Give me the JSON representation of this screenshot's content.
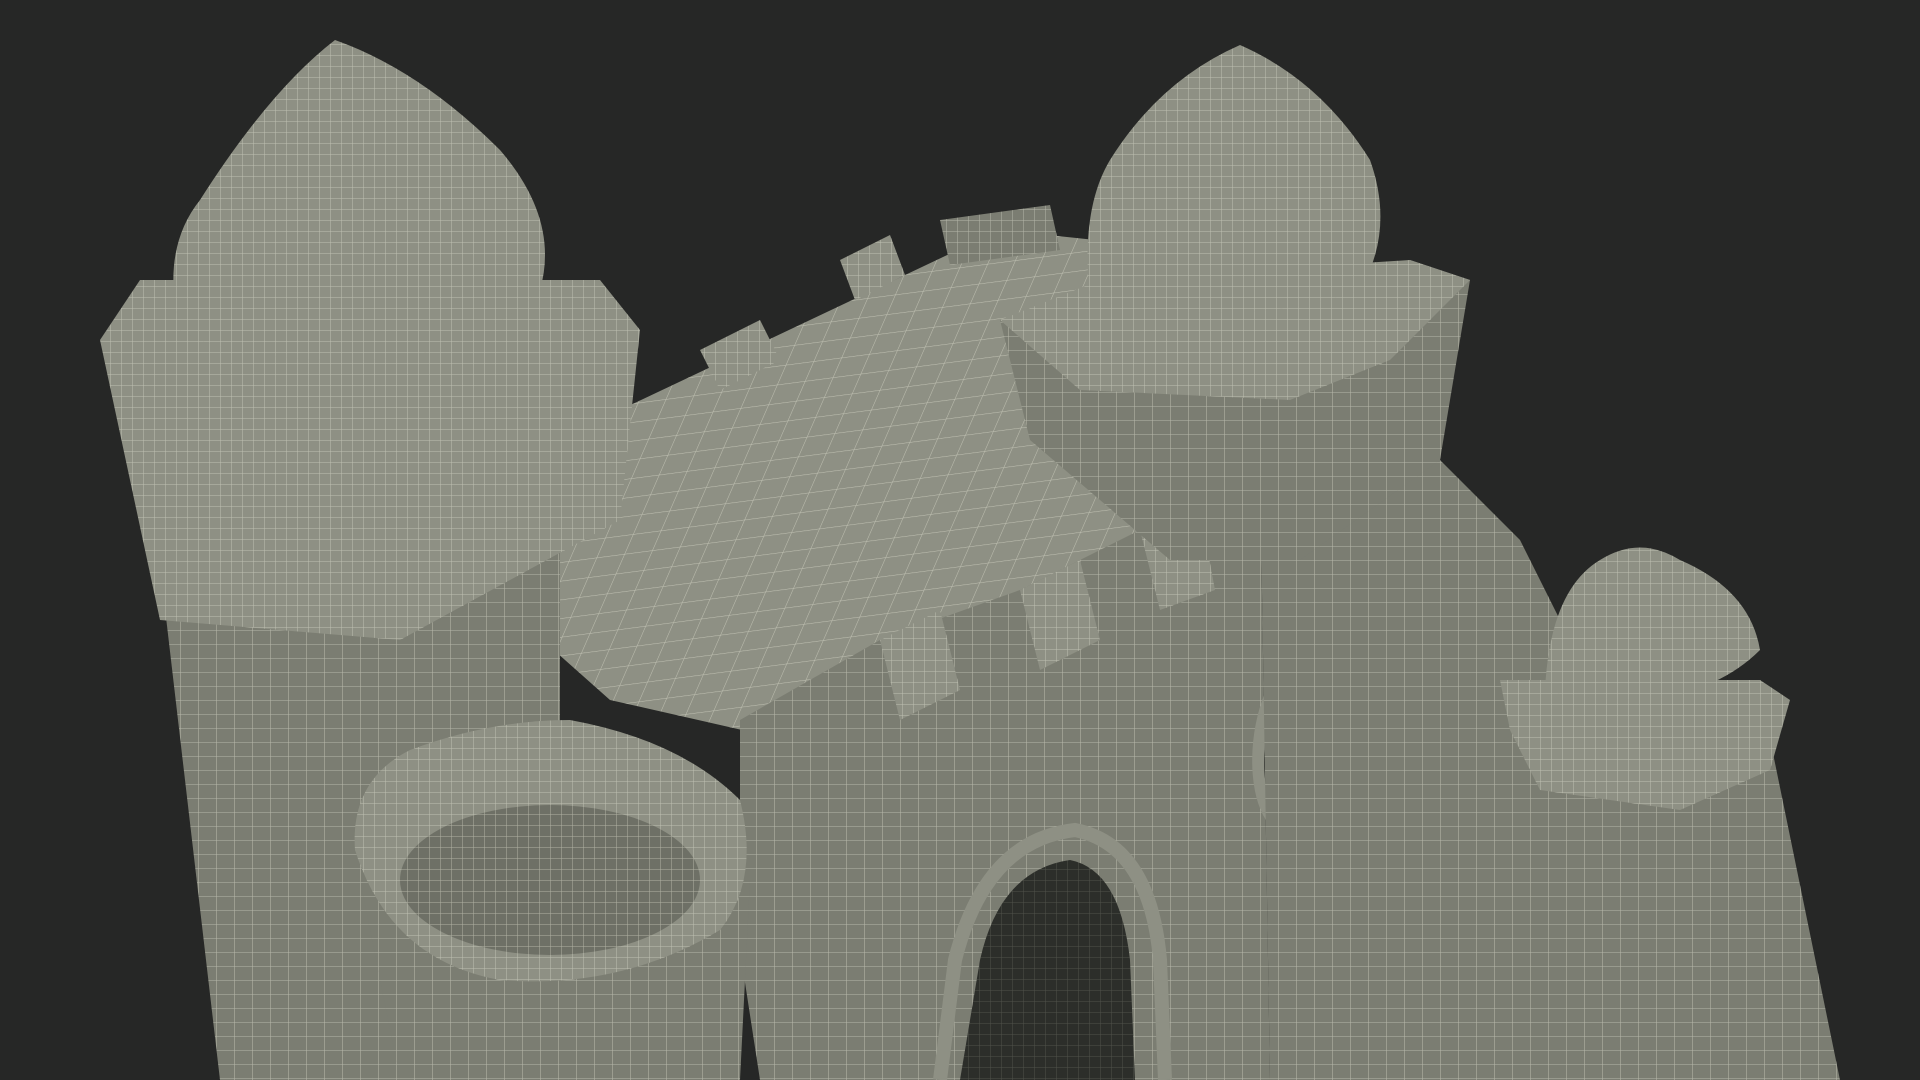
{
  "scene": {
    "subject": "castle-wireframe-render",
    "colors": {
      "background": "#262726",
      "surface": "#7b7d72",
      "surface_light": "#8e9084",
      "surface_dark": "#5d5f56",
      "opening": "#2c2e2a",
      "wire": "#e6e6d6"
    }
  }
}
